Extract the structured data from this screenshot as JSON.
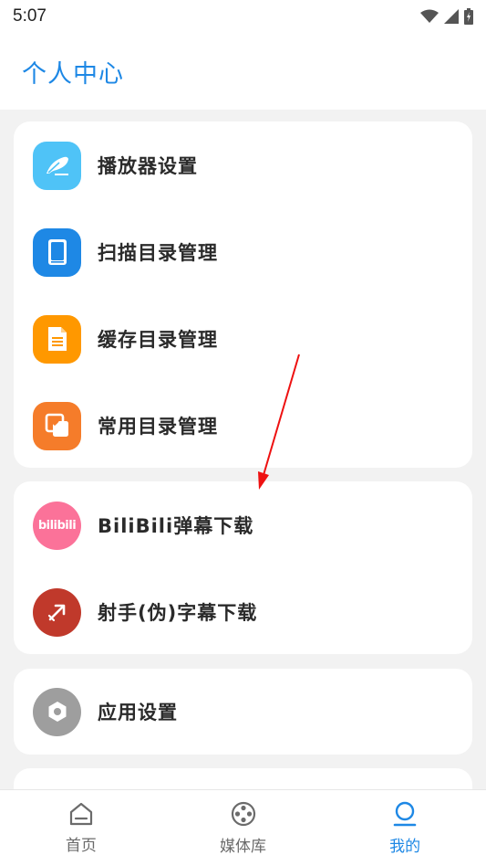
{
  "status_bar": {
    "time": "5:07"
  },
  "header": {
    "title": "个人中心"
  },
  "groups": [
    {
      "items": [
        {
          "label": "播放器设置",
          "icon": "feather-icon",
          "color": "#4fc3f7"
        },
        {
          "label": "扫描目录管理",
          "icon": "book-icon",
          "color": "#1e88e5"
        },
        {
          "label": "缓存目录管理",
          "icon": "document-icon",
          "color": "#ff9800"
        },
        {
          "label": "常用目录管理",
          "icon": "folder-heart-icon",
          "color": "#f57c2a"
        }
      ]
    },
    {
      "items": [
        {
          "label": "BiliBili弹幕下载",
          "icon": "bilibili-logo-icon",
          "icon_text": "bilibili",
          "color": "#fb7299"
        },
        {
          "label": "射手(伪)字幕下载",
          "icon": "arrow-icon",
          "color": "#c0392b"
        }
      ]
    },
    {
      "items": [
        {
          "label": "应用设置",
          "icon": "hex-settings-icon",
          "color": "#9e9e9e"
        }
      ]
    }
  ],
  "bottom_nav": [
    {
      "label": "首页",
      "icon": "home-icon",
      "active": false
    },
    {
      "label": "媒体库",
      "icon": "film-reel-icon",
      "active": false
    },
    {
      "label": "我的",
      "icon": "user-icon",
      "active": true
    }
  ],
  "accent_color": "#1e88e5",
  "annotation_color": "#ee1111"
}
